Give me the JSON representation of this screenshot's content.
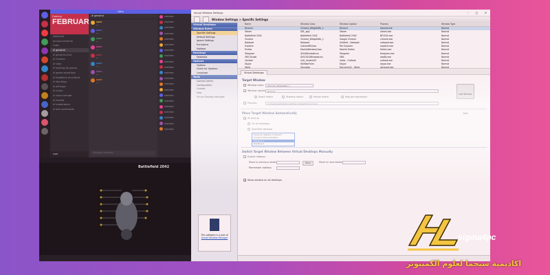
{
  "discord": {
    "banner": "Nitro",
    "server_name": "Gaming",
    "server_month": "FEBRUARY",
    "server_sub": "",
    "channels": [
      "welcome",
      "announcements",
      "rules",
      "# general",
      "# general-chat",
      "# memes",
      "# clips",
      "# looking-for-group",
      "# game-questions",
      "# feedback-and-ideas",
      "# dev-blog",
      "# off-topic",
      "# music",
      "# voice-lounge",
      "# events",
      "# moderators",
      "# bot-commands"
    ],
    "selected_channel": 3,
    "chat_title": "# general",
    "messages": [
      {
        "name": "user",
        "text": "..."
      },
      {
        "name": "user",
        "text": "..."
      },
      {
        "name": "user",
        "text": "..."
      },
      {
        "name": "user",
        "text": "..."
      },
      {
        "name": "user",
        "text": "..."
      },
      {
        "name": "user",
        "text": "..."
      },
      {
        "name": "user",
        "text": "..."
      },
      {
        "name": "user",
        "text": "..."
      }
    ],
    "composer_placeholder": "Message #general",
    "members": [
      "member",
      "member",
      "member",
      "member",
      "member",
      "member",
      "member",
      "member",
      "member",
      "member",
      "member",
      "member",
      "member",
      "member",
      "member",
      "member",
      "member",
      "member",
      "member",
      "member",
      "member"
    ],
    "userbar": "user"
  },
  "game": {
    "header": "",
    "title": "Battlefield 2042",
    "footer": ""
  },
  "aws": {
    "window_title": "Actual Window Settings",
    "crumb": "Window Settings > Specific Settings",
    "left_sections": [
      {
        "title": "Virtual Desktops",
        "items": []
      },
      {
        "title": "Window Rules",
        "items": [
          "Specific Settings",
          "Default Settings",
          "Ignore Settings",
          "Exclusions",
          "Hotkeys"
        ]
      },
      {
        "title": "Desktops",
        "items": [
          "Desktops"
        ]
      },
      {
        "title": "Options",
        "items": [
          "Options",
          "Check for Updates",
          "Language"
        ]
      },
      {
        "title": "Tools",
        "items": [
          "Control Center",
          "Configuration",
          "License",
          "Help",
          "Virtual Desktop Manager"
        ]
      }
    ],
    "selected_item": "Specific Settings",
    "promo_text": "This software is a part of",
    "promo_link": "Actual Window Manager",
    "grid_headers": [
      "",
      "Name",
      "Window Class",
      "Window Caption",
      "Process",
      "Window Type"
    ],
    "grid_rows": [
      [
        "",
        "Discord",
        "Chrome_WidgetWin_1",
        "Discord",
        "discord.exe",
        "Normal"
      ],
      [
        "",
        "Steam",
        "SDL_app",
        "Steam",
        "steam.exe",
        "Normal"
      ],
      [
        "",
        "Battlefield 2042",
        "Battlefield 2042",
        "Battlefield 2042",
        "BF2042.exe",
        "Normal"
      ],
      [
        "",
        "Chrome",
        "Chrome_WidgetWin_1",
        "Google Chrome",
        "chrome.exe",
        "Normal"
      ],
      [
        "",
        "Notepad",
        "Notepad",
        "Untitled - Notepad",
        "notepad.exe",
        "Normal"
      ],
      [
        "",
        "Explorer",
        "CabinetWClass",
        "File Explorer",
        "explorer.exe",
        "Normal"
      ],
      [
        "",
        "Firefox",
        "MozillaWindowClass",
        "Mozilla Firefox",
        "firefox.exe",
        "Normal"
      ],
      [
        "",
        "Telegram",
        "Qt5QWindowIcon",
        "Telegram",
        "telegram.exe",
        "Normal"
      ],
      [
        "",
        "OBS Studio",
        "Qt5152QWindowIcon",
        "OBS",
        "obs64.exe",
        "Normal"
      ],
      [
        "",
        "Outlook",
        "rctrl_renwnd32",
        "Inbox - Outlook",
        "outlook.exe",
        "Normal"
      ],
      [
        "",
        "Skype",
        "tSkMainForm",
        "Skype",
        "skype.exe",
        "Normal"
      ],
      [
        "",
        "Word",
        "OpusApp",
        "Document1 - Word",
        "winword.exe",
        "Normal"
      ]
    ],
    "selected_row": 0,
    "tab": "Virtual Desktops",
    "panel": {
      "target_group": "Target Window",
      "window_class_label": "Window class:",
      "window_class_value": "Chrome_WidgetWin_1",
      "window_caption_label": "Window caption:",
      "window_caption_value": "Discord",
      "exact_match": "Exact match",
      "starting_match": "Starting match",
      "partial_match": "Partial match",
      "regex": "Regular expression",
      "process_label": "Process:",
      "process_value": "C:\\Users\\AppData\\Local\\Discord\\app\\Discord.exe",
      "add_button": "Add Window Rule",
      "place_group": "Place Target Window Automatically",
      "at_startup": "At startup",
      "on_all_desktops": "On all desktops",
      "specified_desktop": "Specified desktop",
      "dropdown_options": [
        "Same as desktop of parent",
        "Current Virtual Desktop",
        "Desktop 1",
        "Desktop 2"
      ],
      "dropdown_selected": 2,
      "switch_group": "Switch Target Window Between Virtual Desktops Manually",
      "enable_hotkeys": "Enable hotkeys",
      "hotkey_a_label": "Move to previous desktop:",
      "hotkey_b_label": "Move to next desktop:",
      "none_button": "None",
      "remember_label": "Remember hotkeys",
      "show_on_all": "Show window on all desktops"
    }
  },
  "watermark": {
    "brand": "sigma4pc",
    "arabic": "اكاديمية سيجما لعلوم الكمبيوتر"
  }
}
